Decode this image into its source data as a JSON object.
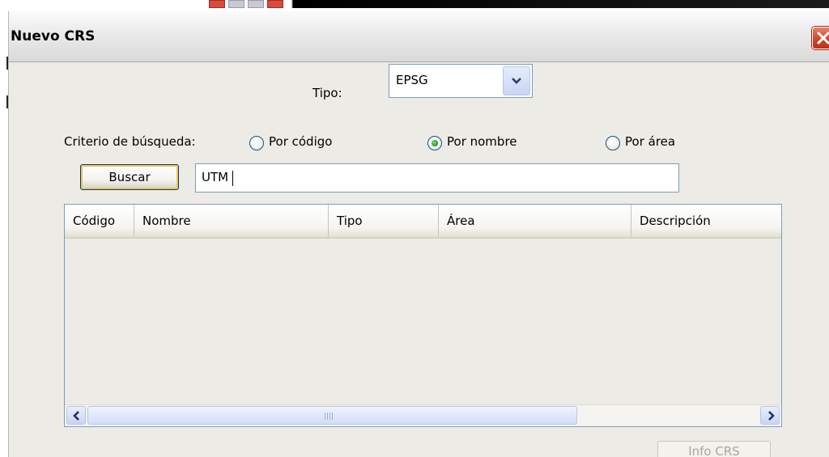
{
  "dialog": {
    "title": "Nuevo CRS",
    "close_icon": "close-icon"
  },
  "tipo": {
    "label": "Tipo:",
    "selected": "EPSG"
  },
  "search": {
    "criteria_label": "Criterio de búsqueda:",
    "options": [
      {
        "label": "Por código",
        "checked": false
      },
      {
        "label": "Por nombre",
        "checked": true
      },
      {
        "label": "Por área",
        "checked": false
      }
    ],
    "button_label": "Buscar",
    "query": "UTM"
  },
  "table": {
    "columns": [
      "Código",
      "Nombre",
      "Tipo",
      "Área",
      "Descripción"
    ],
    "rows": []
  },
  "info_button_label": "Info CRS"
}
